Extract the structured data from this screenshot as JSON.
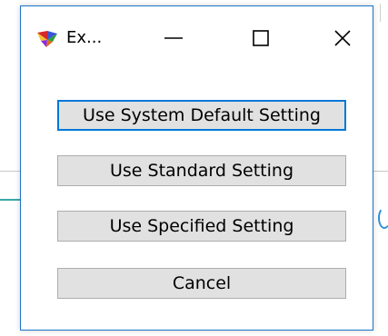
{
  "dialog": {
    "title": "Ex...",
    "app_icon": "palette-icon",
    "window_controls": {
      "minimize_icon": "minimize-icon",
      "maximize_icon": "maximize-icon",
      "close_icon": "close-icon"
    },
    "buttons": [
      {
        "label": "Use System Default Setting",
        "focused": true
      },
      {
        "label": "Use Standard Setting",
        "focused": false
      },
      {
        "label": "Use Specified Setting",
        "focused": false
      },
      {
        "label": "Cancel",
        "focused": false
      }
    ]
  },
  "colors": {
    "dialog_border": "#1f73c7",
    "focus_border": "#0078d7",
    "button_face": "#e1e1e1",
    "button_border": "#adadad"
  }
}
